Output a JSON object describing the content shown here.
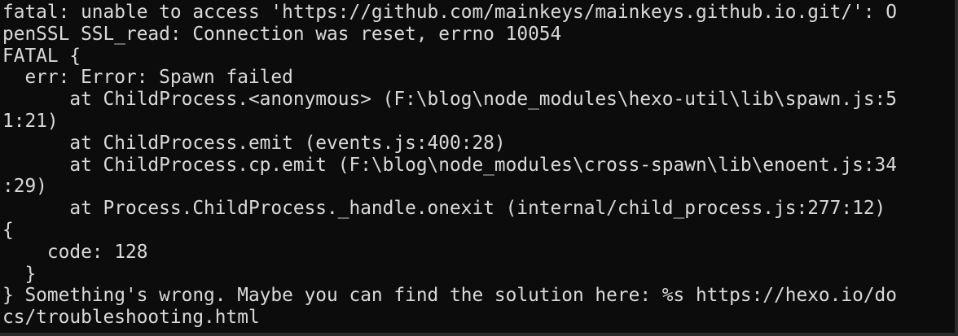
{
  "terminal": {
    "lines": [
      "fatal: unable to access 'https://github.com/mainkeys/mainkeys.github.io.git/': O",
      "penSSL SSL_read: Connection was reset, errno 10054",
      "FATAL {",
      "  err: Error: Spawn failed",
      "      at ChildProcess.<anonymous> (F:\\blog\\node_modules\\hexo-util\\lib\\spawn.js:5",
      "1:21)",
      "      at ChildProcess.emit (events.js:400:28)",
      "      at ChildProcess.cp.emit (F:\\blog\\node_modules\\cross-spawn\\lib\\enoent.js:34",
      ":29)",
      "      at Process.ChildProcess._handle.onexit (internal/child_process.js:277:12)",
      "{",
      "    code: 128",
      "  }",
      "} Something's wrong. Maybe you can find the solution here: %s https://hexo.io/do",
      "cs/troubleshooting.html"
    ]
  }
}
